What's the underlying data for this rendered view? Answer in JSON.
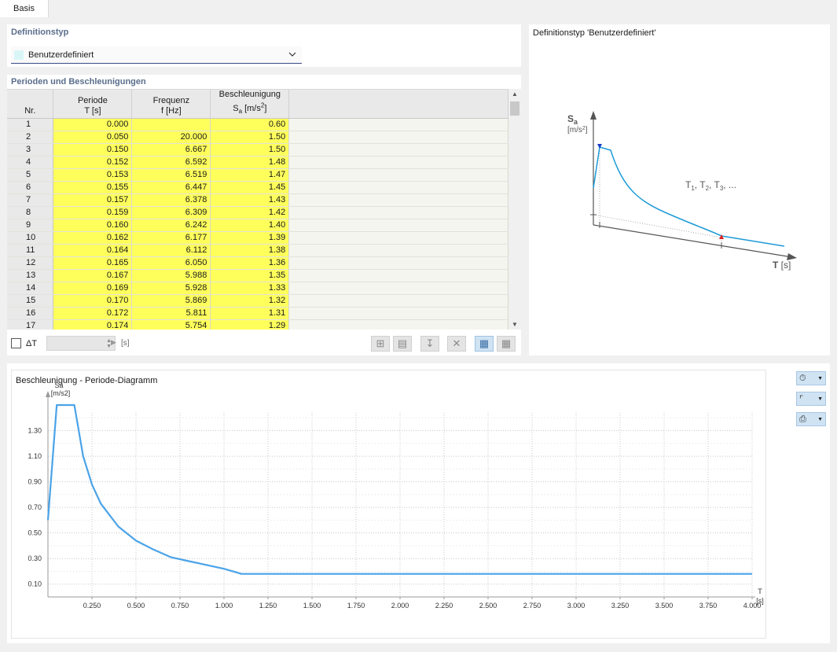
{
  "tabs": [
    {
      "label": "Basis"
    }
  ],
  "definition": {
    "title": "Definitionstyp",
    "value": "Benutzerdefiniert",
    "swatch_color": "#d9f6f7"
  },
  "table": {
    "title": "Perioden und Beschleunigungen",
    "headers": {
      "nr": "Nr.",
      "period": "Periode",
      "period_unit": "T [s]",
      "freq": "Frequenz",
      "freq_unit": "f [Hz]",
      "accel": "Beschleunigung",
      "accel_unit": "Sa [m/s2]"
    },
    "rows": [
      {
        "nr": "1",
        "t": "0.000",
        "f": "",
        "sa": "0.60"
      },
      {
        "nr": "2",
        "t": "0.050",
        "f": "20.000",
        "sa": "1.50"
      },
      {
        "nr": "3",
        "t": "0.150",
        "f": "6.667",
        "sa": "1.50"
      },
      {
        "nr": "4",
        "t": "0.152",
        "f": "6.592",
        "sa": "1.48"
      },
      {
        "nr": "5",
        "t": "0.153",
        "f": "6.519",
        "sa": "1.47"
      },
      {
        "nr": "6",
        "t": "0.155",
        "f": "6.447",
        "sa": "1.45"
      },
      {
        "nr": "7",
        "t": "0.157",
        "f": "6.378",
        "sa": "1.43"
      },
      {
        "nr": "8",
        "t": "0.159",
        "f": "6.309",
        "sa": "1.42"
      },
      {
        "nr": "9",
        "t": "0.160",
        "f": "6.242",
        "sa": "1.40"
      },
      {
        "nr": "10",
        "t": "0.162",
        "f": "6.177",
        "sa": "1.39"
      },
      {
        "nr": "11",
        "t": "0.164",
        "f": "6.112",
        "sa": "1.38"
      },
      {
        "nr": "12",
        "t": "0.165",
        "f": "6.050",
        "sa": "1.36"
      },
      {
        "nr": "13",
        "t": "0.167",
        "f": "5.988",
        "sa": "1.35"
      },
      {
        "nr": "14",
        "t": "0.169",
        "f": "5.928",
        "sa": "1.33"
      },
      {
        "nr": "15",
        "t": "0.170",
        "f": "5.869",
        "sa": "1.32"
      },
      {
        "nr": "16",
        "t": "0.172",
        "f": "5.811",
        "sa": "1.31"
      },
      {
        "nr": "17",
        "t": "0.174",
        "f": "5.754",
        "sa": "1.29"
      }
    ],
    "highlight_color": "#ffff5c",
    "delta_label": "ΔT",
    "delta_unit": "[s]"
  },
  "preview": {
    "title": "Definitionstyp 'Benutzerdefiniert'",
    "y_symbol": "Sa",
    "y_unit": "[m/s2]",
    "x_label": "T [s]",
    "periods_label": "T1, T2, T3, ..."
  },
  "diagram": {
    "title": "Beschleunigung - Periode-Diagramm",
    "line_color": "#4aa3e8"
  },
  "chart_data": {
    "type": "line",
    "title": "Beschleunigung - Periode-Diagramm",
    "xlabel": "T",
    "xunit": "[s]",
    "ylabel": "Sa",
    "yunit": "[m/s2]",
    "xlim": [
      0,
      4.0
    ],
    "ylim": [
      0,
      1.5
    ],
    "grid": true,
    "x_ticks": [
      "0.250",
      "0.500",
      "0.750",
      "1.000",
      "1.250",
      "1.500",
      "1.750",
      "2.000",
      "2.250",
      "2.500",
      "2.750",
      "3.000",
      "3.250",
      "3.500",
      "3.750",
      "4.000"
    ],
    "y_ticks": [
      "0.10",
      "0.30",
      "0.50",
      "0.70",
      "0.90",
      "1.10",
      "1.30"
    ],
    "series": [
      {
        "x": [
          0.0,
          0.05,
          0.15,
          0.2,
          0.25,
          0.3,
          0.4,
          0.5,
          0.6,
          0.7,
          0.8,
          0.9,
          1.0,
          1.1,
          1.5,
          2.0,
          2.5,
          3.0,
          3.5,
          4.0
        ],
        "y": [
          0.6,
          1.5,
          1.5,
          1.1,
          0.88,
          0.73,
          0.55,
          0.44,
          0.37,
          0.31,
          0.28,
          0.25,
          0.22,
          0.18,
          0.18,
          0.18,
          0.18,
          0.18,
          0.18,
          0.18
        ]
      }
    ]
  }
}
